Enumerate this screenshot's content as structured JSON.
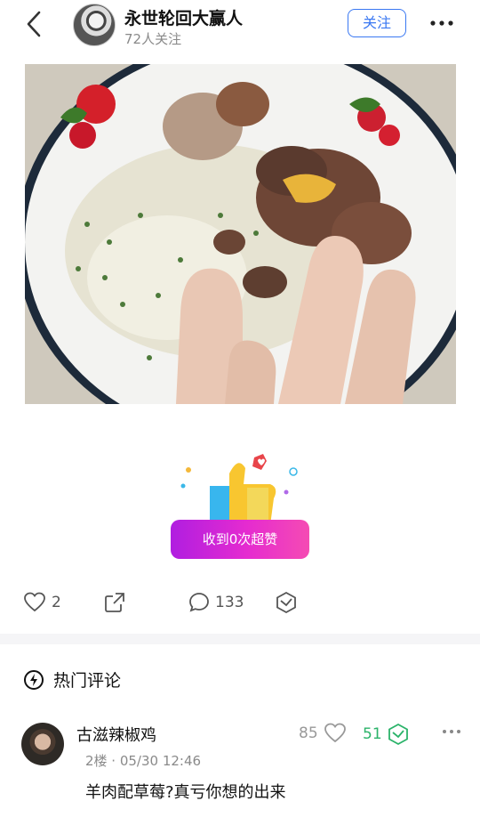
{
  "header": {
    "username": "永世轮回大赢人",
    "followers": "72人关注",
    "follow_label": "关注"
  },
  "post": {
    "image_icon": "food-photo",
    "superlike_label": "收到0次超赞",
    "like_count": "2",
    "comment_count": "133"
  },
  "comments": {
    "section_title": "热门评论",
    "items": [
      {
        "author": "古滋辣椒鸡",
        "meta": "2楼 · 05/30 12:46",
        "text": "羊肉配草莓?真亏你想的出来",
        "likes": "85",
        "super_likes": "51"
      }
    ]
  },
  "colors": {
    "accent": "#3a78f2",
    "superlike_gradient_start": "#b01ee0",
    "superlike_gradient_end": "#f54bb3",
    "super_green": "#2bb36a"
  }
}
